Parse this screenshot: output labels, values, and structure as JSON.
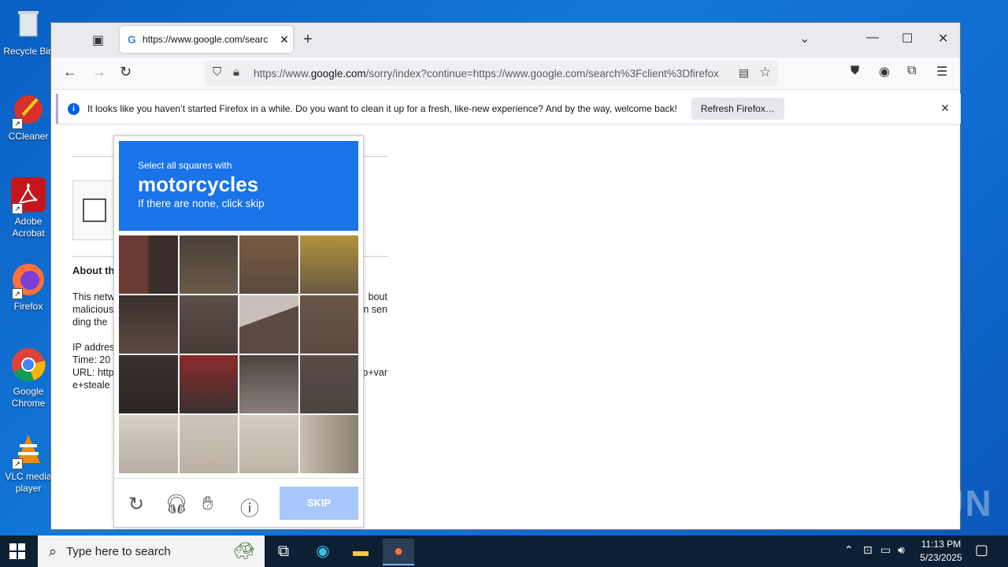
{
  "desktop": {
    "icons": [
      {
        "label": "Recycle Bin",
        "icon": "recycle-bin"
      },
      {
        "label": "CCleaner",
        "icon": "ccleaner"
      },
      {
        "label": "Adobe Acrobat",
        "icon": "adobe-acrobat"
      },
      {
        "label": "Firefox",
        "icon": "firefox"
      },
      {
        "label": "Google Chrome",
        "icon": "chrome"
      },
      {
        "label": "VLC media player",
        "icon": "vlc"
      }
    ]
  },
  "browser": {
    "tab_title": "https://www.google.com/searc",
    "url_prefix": "https://www.",
    "url_domain": "google.com",
    "url_rest": "/sorry/index?continue=https://www.google.com/search%3Fclient%3Dfirefox",
    "infobar_message": "It looks like you haven’t started Firefox in a while. Do you want to clean it up for a fresh, like-new experience? And by the way, welcome back!",
    "infobar_button": "Refresh Firefox…"
  },
  "page": {
    "about_heading": "About th",
    "para1_line1": "This netw",
    "para1_line1_right": "bout",
    "para1_line2": "malicious",
    "para1_line2_right": "n sen",
    "para1_line3": "ding the",
    "ip_label": "IP addres",
    "time_label": "Time: 20",
    "url_label": "URL: http",
    "url_right": "p+var",
    "url_line2": "e+steale"
  },
  "captcha": {
    "line1": "Select all squares with",
    "target": "motorcycles",
    "line3": "If there are none, click skip",
    "skip_label": "SKIP"
  },
  "watermark": "ANY RUN",
  "taskbar": {
    "search_placeholder": "Type here to search",
    "time": "11:13 PM",
    "date": "5/23/2025"
  }
}
